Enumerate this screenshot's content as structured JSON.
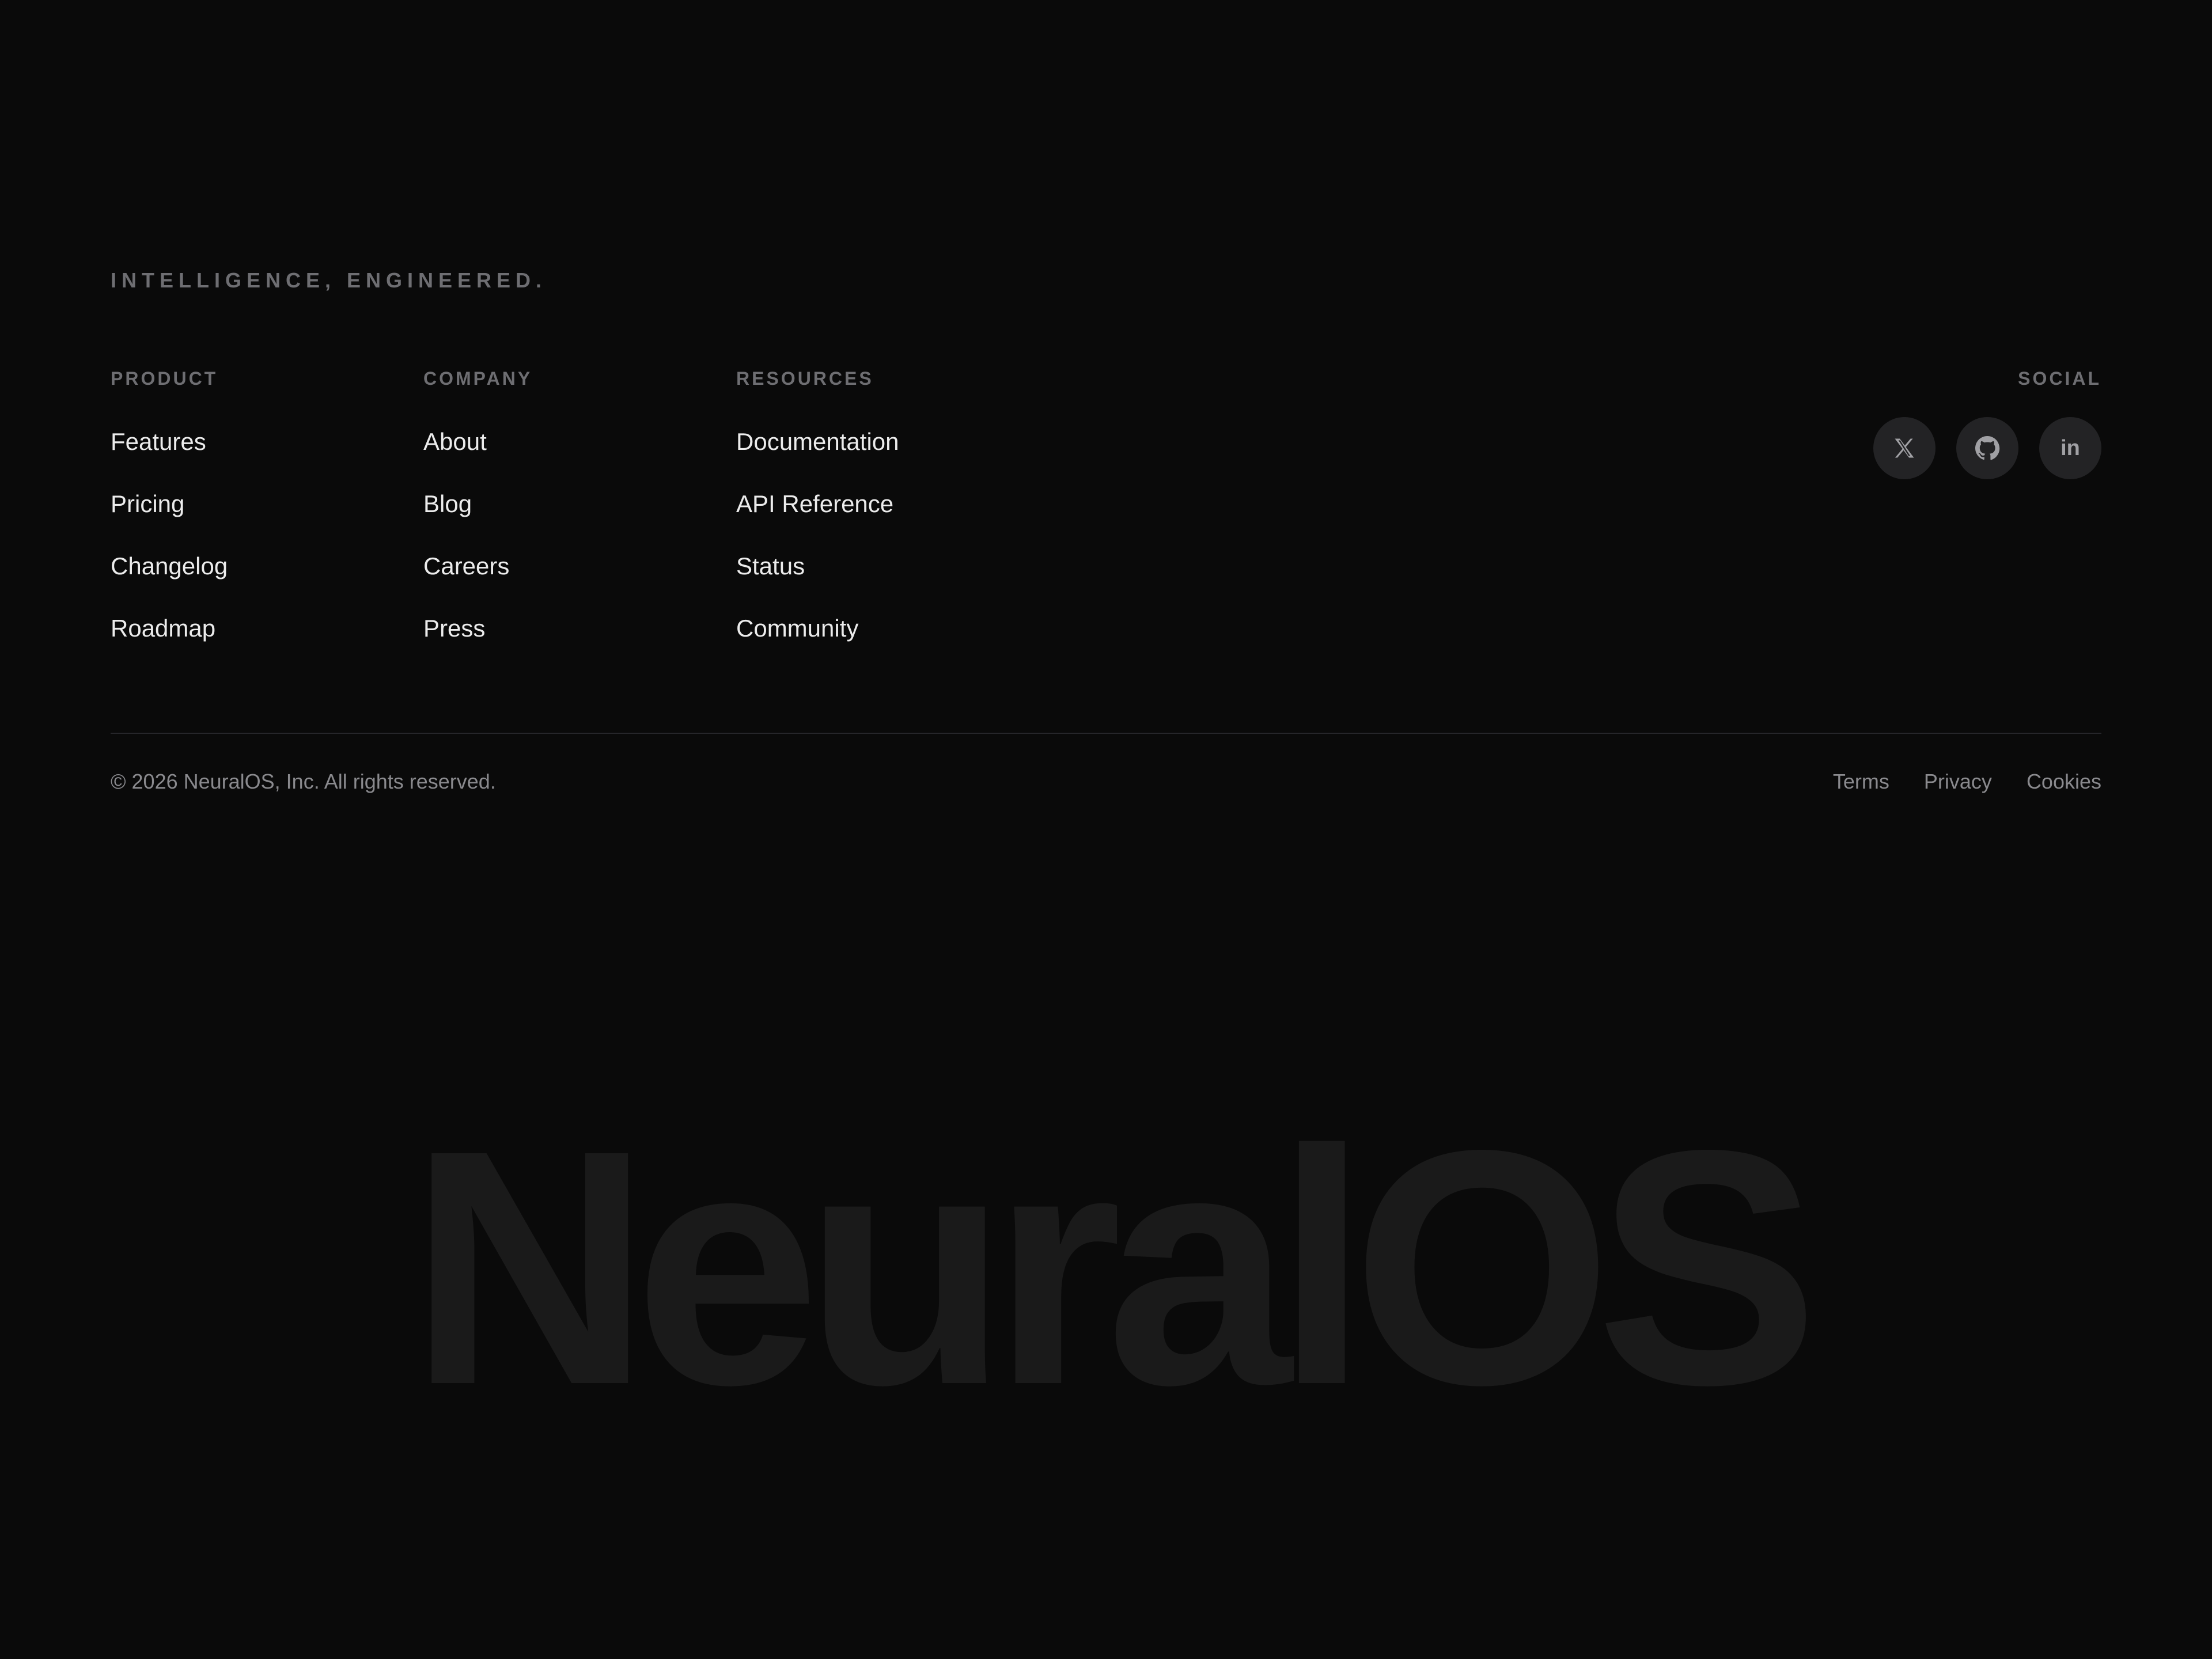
{
  "tagline": "INTELLIGENCE, ENGINEERED.",
  "columns": {
    "product": {
      "heading": "PRODUCT",
      "links": [
        "Features",
        "Pricing",
        "Changelog",
        "Roadmap"
      ]
    },
    "company": {
      "heading": "COMPANY",
      "links": [
        "About",
        "Blog",
        "Careers",
        "Press"
      ]
    },
    "resources": {
      "heading": "RESOURCES",
      "links": [
        "Documentation",
        "API Reference",
        "Status",
        "Community"
      ]
    }
  },
  "social": {
    "heading": "SOCIAL",
    "icons": [
      "x-icon",
      "github-icon",
      "linkedin-icon"
    ],
    "linkedin_glyph": "in"
  },
  "footer": {
    "copyright": "© 2026 NeuralOS, Inc. All rights reserved.",
    "legal_links": [
      "Terms",
      "Privacy",
      "Cookies"
    ]
  },
  "wordmark": "NeuralOS",
  "colors": {
    "background": "#0a0a0a",
    "muted_text": "#6e6e72",
    "link_text": "#ececec",
    "icon_button_bg": "#232325",
    "wordmark": "#1a1a1a"
  }
}
